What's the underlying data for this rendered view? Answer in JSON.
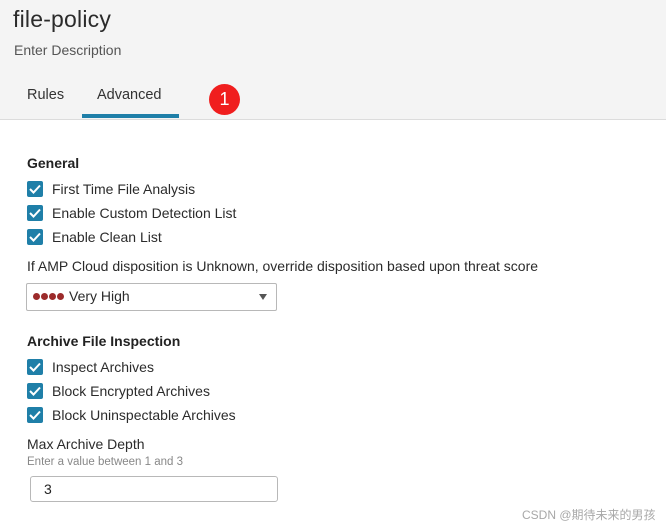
{
  "header": {
    "title": "file-policy",
    "description": "Enter Description"
  },
  "tabs": [
    {
      "label": "Rules",
      "active": false
    },
    {
      "label": "Advanced",
      "active": true
    }
  ],
  "badge": "1",
  "accent_color": "#1f7fa8",
  "badge_color": "#f01e1e",
  "general": {
    "title": "General",
    "checkboxes": [
      {
        "label": "First Time File Analysis",
        "checked": true
      },
      {
        "label": "Enable Custom Detection List",
        "checked": true
      },
      {
        "label": "Enable Clean List",
        "checked": true
      }
    ],
    "disposition_label": "If AMP Cloud disposition is Unknown, override disposition based upon threat score",
    "threat_select": {
      "value": "Very High",
      "indicator_dots": 4,
      "dot_color": "#9c2b2b"
    }
  },
  "archive": {
    "title": "Archive File Inspection",
    "checkboxes": [
      {
        "label": "Inspect Archives",
        "checked": true
      },
      {
        "label": "Block Encrypted Archives",
        "checked": true
      },
      {
        "label": "Block Uninspectable Archives",
        "checked": true
      }
    ],
    "depth_label": "Max Archive Depth",
    "depth_hint": "Enter a value between 1 and 3",
    "depth_value": "3"
  },
  "watermark": "CSDN @期待未来的男孩"
}
